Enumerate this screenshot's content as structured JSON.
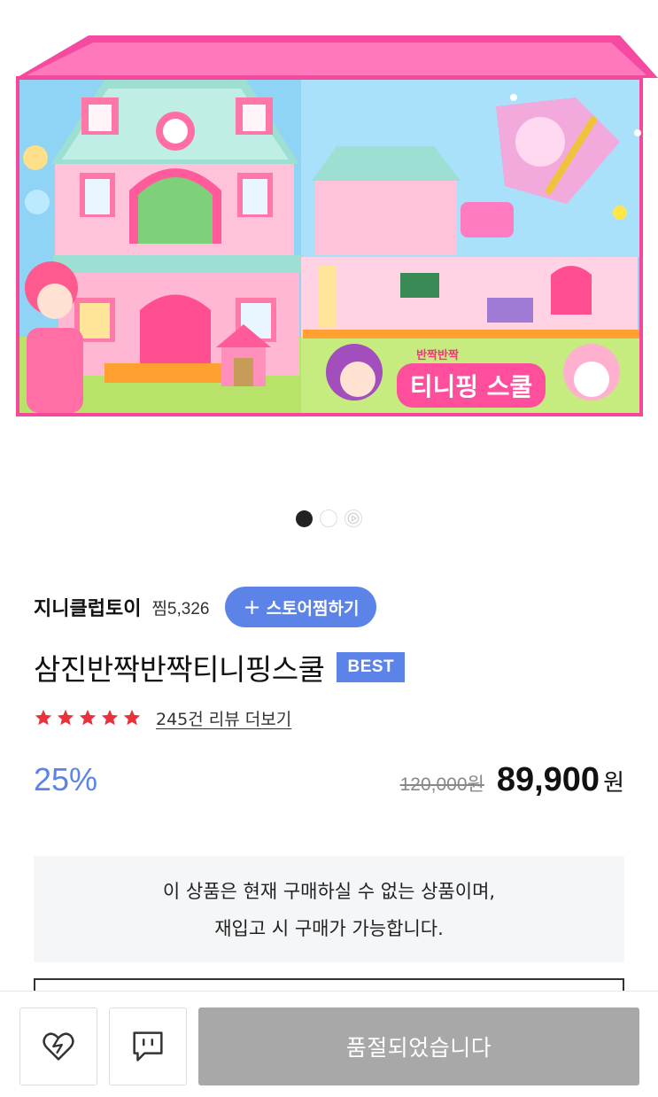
{
  "product_image": {
    "box_brand_text": "반짝반짝",
    "box_title_text": "티니핑 스쿨"
  },
  "carousel": {
    "total_slides": 3,
    "active_index": 0
  },
  "store": {
    "name": "지니클럽토이",
    "likes": "찜5,326",
    "like_button_label": "스토어찜하기",
    "like_button_icon": "plus-icon"
  },
  "product": {
    "title": "삼진반짝반짝티니핑스쿨",
    "badge": "BEST"
  },
  "rating": {
    "stars": 5,
    "review_link": "245건 리뷰 더보기"
  },
  "price": {
    "discount": "25%",
    "original": "120,000원",
    "sale": "89,900",
    "currency": "원"
  },
  "notice": {
    "line1": "이 상품은 현재 구매하실 수 없는 상품이며,",
    "line2": "재입고 시 구매가 가능합니다."
  },
  "bottom_bar": {
    "like_icon": "heart-icon",
    "talk_icon": "talk-icon",
    "soldout_label": "품절되었습니다"
  },
  "colors": {
    "accent": "#5c84e8",
    "star": "#e8323c",
    "soldout": "#a8a8a8"
  }
}
